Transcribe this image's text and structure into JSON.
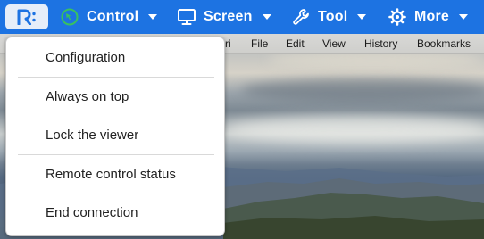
{
  "toolbar": {
    "logo": "remote-desktop-logo",
    "items": [
      {
        "label": "Control",
        "icon": "control-icon"
      },
      {
        "label": "Screen",
        "icon": "monitor-icon"
      },
      {
        "label": "Tool",
        "icon": "wrench-icon"
      },
      {
        "label": "More",
        "icon": "gear-icon"
      }
    ],
    "colors": {
      "bar": "#1d73e2",
      "control_icon": "#38c15f",
      "text": "#ffffff"
    }
  },
  "dropdown": {
    "items": [
      {
        "label": "Configuration"
      },
      {
        "label": "Always on top"
      },
      {
        "label": "Lock the viewer"
      },
      {
        "label": "Remote control status"
      },
      {
        "label": "End connection"
      }
    ]
  },
  "remote_screen": {
    "menubar": [
      "ri",
      "File",
      "Edit",
      "View",
      "History",
      "Bookmarks"
    ]
  }
}
